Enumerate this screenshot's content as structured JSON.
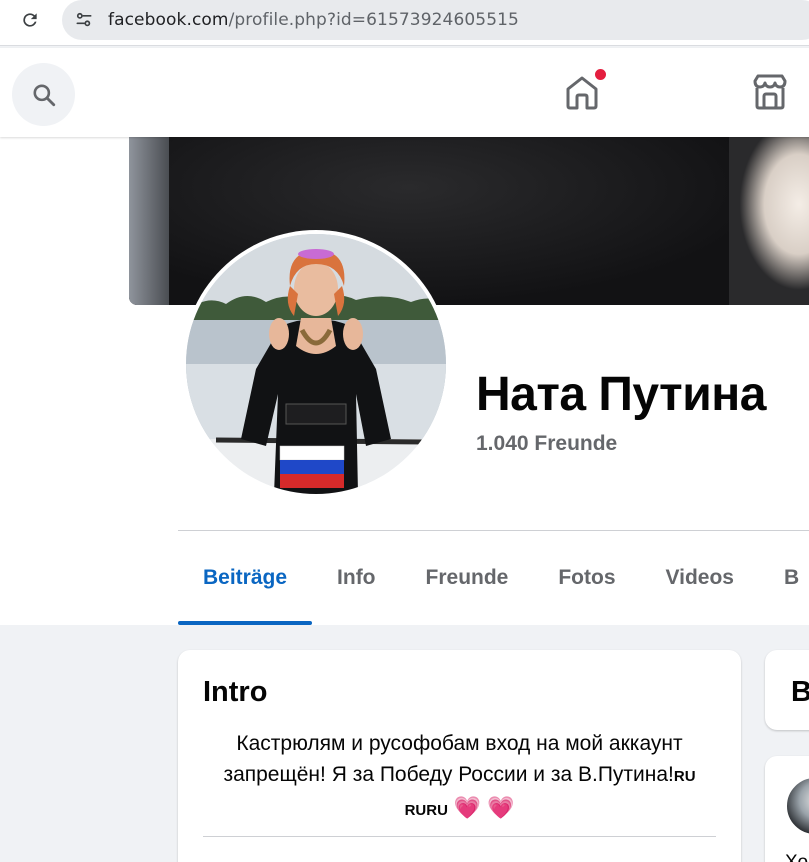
{
  "browser": {
    "url_host": "facebook.com",
    "url_rest": "/profile.php?id=61573924605515"
  },
  "nav": {
    "has_home_notification": true,
    "icons": [
      "search-icon",
      "home-icon",
      "marketplace-icon"
    ]
  },
  "profile": {
    "name": "Ната Путина",
    "friends": "1.040 Freunde"
  },
  "tabs": [
    {
      "label": "Beiträge",
      "active": true
    },
    {
      "label": "Info",
      "active": false
    },
    {
      "label": "Freunde",
      "active": false
    },
    {
      "label": "Fotos",
      "active": false
    },
    {
      "label": "Videos",
      "active": false
    },
    {
      "label": "B",
      "active": false
    }
  ],
  "intro": {
    "title": "Intro",
    "bio_line1": "Кастрюлям и русофобам вход на мой аккаунт",
    "bio_line2": "запрещён! Я за Победу России и за В.Путина!",
    "bio_flag1": "RU",
    "bio_flag2": "RU",
    "bio_flag3": "RU",
    "heart": "💗"
  },
  "right_cards": {
    "card1_title": "B",
    "card2_text": "Хо"
  },
  "colors": {
    "accent": "#0a66c2",
    "notification": "#e41e3f",
    "heart": "#f02e88"
  }
}
